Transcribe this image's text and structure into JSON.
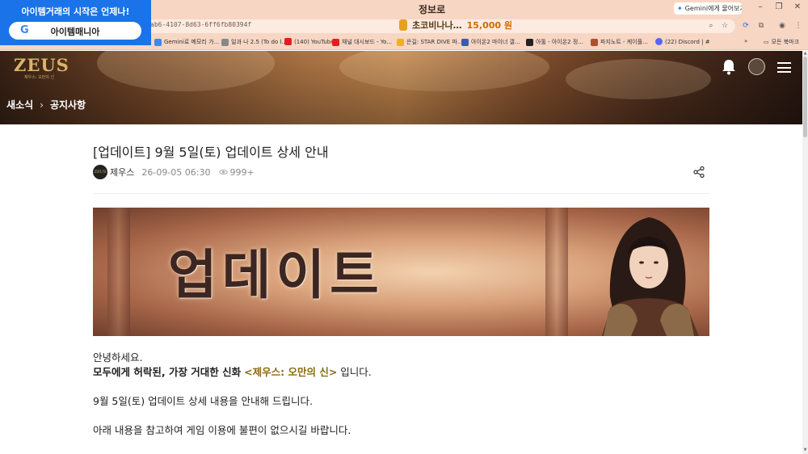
{
  "browser": {
    "tab_title": "정보로",
    "gemini_button": "Gemini에게 물어보기",
    "url": "ab6-4107-8d63-6ff6fb80394f",
    "ad_center": {
      "name": "초코비나나…",
      "price": "15,000 원"
    },
    "bookmarks": [
      "Gemini로 메모리 가...",
      "일과 나 2.5 (To do l...",
      "(140) YouTube",
      "채널 대시보드 - Yo...",
      "은길: STAR DIVE 파...",
      "아이온2 마이너 갤...",
      "아툴 - 아이온2 정...",
      "파지노트 - 케이플...",
      "(22) Discord | #",
      "모든 북마크"
    ]
  },
  "ad_overlay": {
    "title": "아이템거래의 시작은 언제나!",
    "name": "아이템매니아"
  },
  "site": {
    "logo": "ZEUS",
    "logo_sub": "제우스: 오만의 신",
    "breadcrumb": [
      "새소식",
      "공지사항"
    ]
  },
  "article": {
    "title": "[업데이트] 9월 5일(토) 업데이트 상세 안내",
    "author_logo": "ZEUS",
    "author": "제우스",
    "date": "26-09-05 06:30",
    "views": "999+",
    "banner_text": "업데이트",
    "body": {
      "greeting": "안녕하세요.",
      "line2_bold": "모두에게 허락된, 가장 거대한 신화",
      "line2_game": "<제우스: 오만의 신>",
      "line2_end": " 입니다.",
      "line3": "9월 5일(토) 업데이트 상세 내용을 안내해 드립니다.",
      "line4": "아래 내용을 참고하여 게임 이용에 불편이 없으시길 바랍니다."
    }
  },
  "colors": {
    "chrome_bg": "#f7d6c4",
    "ad_blue": "#1a73e8",
    "logo_gold": "#d9b46a",
    "game_title_gold": "#8a6a10"
  }
}
